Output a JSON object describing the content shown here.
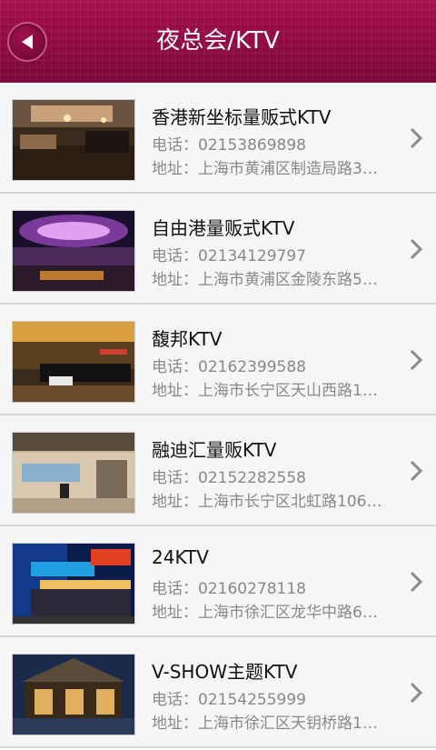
{
  "header": {
    "title": "夜总会/KTV"
  },
  "items": [
    {
      "name": "香港新坐标量贩式KTV",
      "phone": "电话：02153869898",
      "address": "地址：上海市黄浦区制造局路3…"
    },
    {
      "name": "自由港量贩式KTV",
      "phone": "电话：02134129797",
      "address": "地址：上海市黄浦区金陵东路5…"
    },
    {
      "name": "馥邦KTV",
      "phone": "电话：02162399588",
      "address": "地址：上海市长宁区天山西路1…"
    },
    {
      "name": "融迪汇量贩KTV",
      "phone": "电话：02152282558",
      "address": "地址：上海市长宁区北虹路106…"
    },
    {
      "name": "24KTV",
      "phone": "电话：02160278118",
      "address": "地址：上海市徐汇区龙华中路6…"
    },
    {
      "name": "V-SHOW主题KTV",
      "phone": "电话：02154255999",
      "address": "地址：上海市徐汇区天钥桥路1…"
    }
  ],
  "icons": {
    "back": "back-arrow-icon",
    "chevron": "chevron-right-icon"
  },
  "colors": {
    "header": "#8d0a43",
    "text": "#111111",
    "secondary": "#888888"
  }
}
